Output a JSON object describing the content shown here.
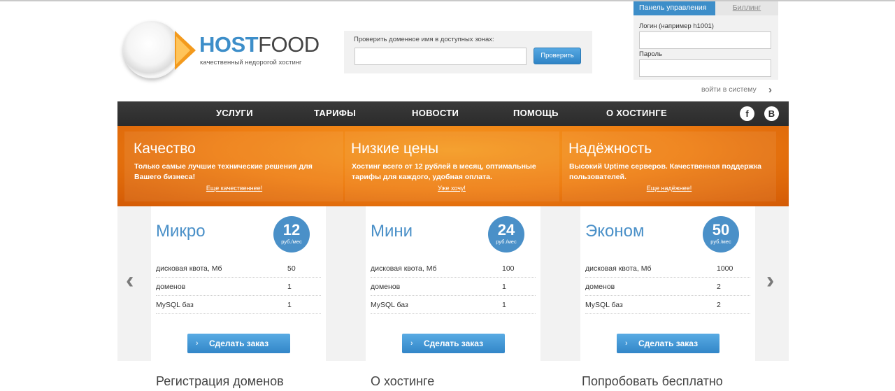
{
  "logo": {
    "brand_part1": "HOST",
    "brand_part2": "FOOD",
    "tagline": "качественный недорогой хостинг"
  },
  "domain_check": {
    "label": "Проверить доменное имя в доступных зонах:",
    "input_value": "",
    "button_label": "Проверить"
  },
  "login": {
    "tab_panel": "Панель управления",
    "tab_billing": "Биллинг",
    "login_label": "Логин (например h1001)",
    "password_label": "Пароль",
    "submit_link": "войти в систему"
  },
  "nav": {
    "items": [
      "УСЛУГИ",
      "ТАРИФЫ",
      "НОВОСТИ",
      "ПОМОЩЬ",
      "О ХОСТИНГЕ"
    ],
    "social": [
      "f",
      "B"
    ]
  },
  "banner": [
    {
      "title": "Качество",
      "text": "Только самые лучшие технические решения для Вашего бизнеса!",
      "link": "Еще качественнее!"
    },
    {
      "title": "Низкие цены",
      "text": "Хостинг всего от 12 рублей в месяц, оптимальные тарифы для каждого, удобная оплата.",
      "link": "Уже хочу!"
    },
    {
      "title": "Надёжность",
      "text": "Высокий Uptime серверов. Качественная поддержка пользователей.",
      "link": "Еще надёжнее!"
    }
  ],
  "tariffs": [
    {
      "name": "Микро",
      "price": "12",
      "unit": "руб./мес",
      "rows": [
        [
          "дисковая квота, Мб",
          "50"
        ],
        [
          "доменов",
          "1"
        ],
        [
          "MySQL баз",
          "1"
        ]
      ],
      "button": "Сделать заказ"
    },
    {
      "name": "Мини",
      "price": "24",
      "unit": "руб./мес",
      "rows": [
        [
          "дисковая квота, Мб",
          "100"
        ],
        [
          "доменов",
          "1"
        ],
        [
          "MySQL баз",
          "1"
        ]
      ],
      "button": "Сделать заказ"
    },
    {
      "name": "Эконом",
      "price": "50",
      "unit": "руб./мес",
      "rows": [
        [
          "дисковая квота, Мб",
          "1000"
        ],
        [
          "доменов",
          "2"
        ],
        [
          "MySQL баз",
          "2"
        ]
      ],
      "button": "Сделать заказ"
    }
  ],
  "bottom": {
    "col1": "Регистрация доменов",
    "col2": "О хостинге",
    "col3": "Попробовать бесплатно"
  },
  "colors": {
    "accent_blue": "#3d8ec9",
    "banner_orange": "#ee7d12",
    "nav_dark": "#2d2d2d"
  }
}
